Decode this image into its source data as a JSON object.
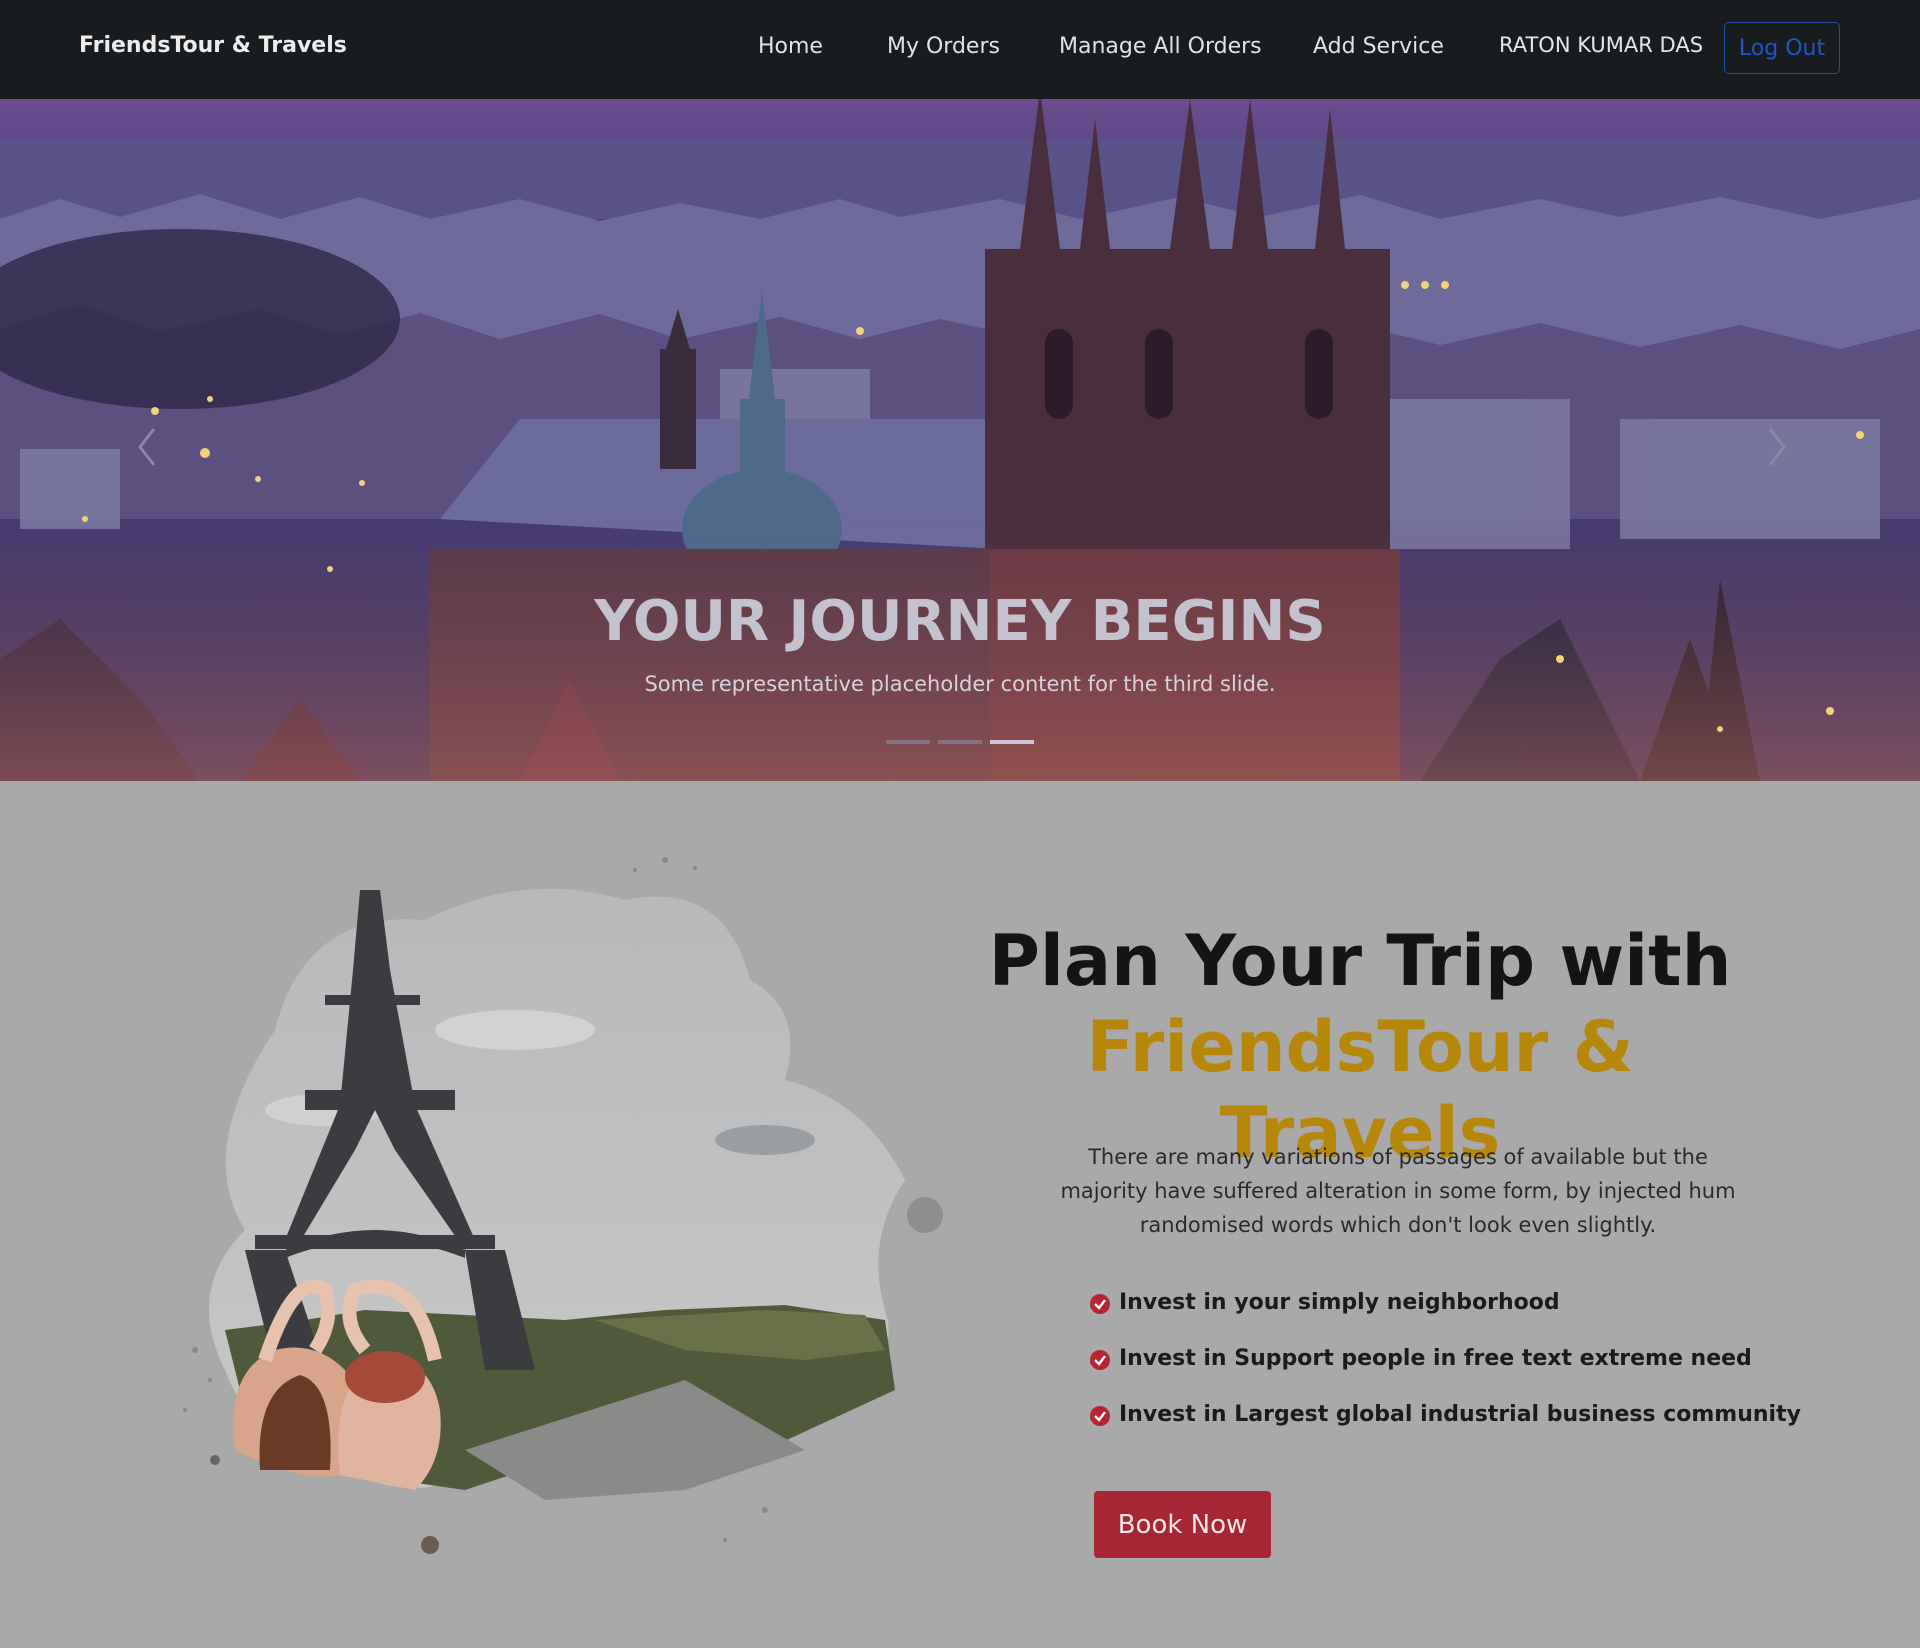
{
  "navbar": {
    "brand": "FriendsTour & Travels",
    "links": [
      "Home",
      "My Orders",
      "Manage All Orders",
      "Add Service"
    ],
    "user": "RATON KUMAR DAS",
    "logout_label": "Log Out",
    "background": "#191c1e",
    "logout_color": "#1f56c9"
  },
  "hero": {
    "title": "YOUR JOURNEY BEGINS",
    "subtitle": "Some representative placeholder content for the third slide.",
    "prev_icon": "chevron-left-icon",
    "next_icon": "chevron-right-icon",
    "slide_count": 3,
    "active_slide": 3
  },
  "plan": {
    "title_line1": "Plan Your Trip with",
    "title_line2": "FriendsTour & Travels",
    "description": "There are many variations of passages of available but the majority have suffered alteration in some form, by injected hum randomised words which don't look even slightly.",
    "features": [
      "Invest in your simply neighborhood",
      "Invest in Support people in free text extreme need",
      "Invest in Largest global industrial business community"
    ],
    "feature_icon": "check-circle-icon",
    "book_label": "Book Now",
    "accent_color": "#b7870a",
    "button_color": "#a72634"
  }
}
